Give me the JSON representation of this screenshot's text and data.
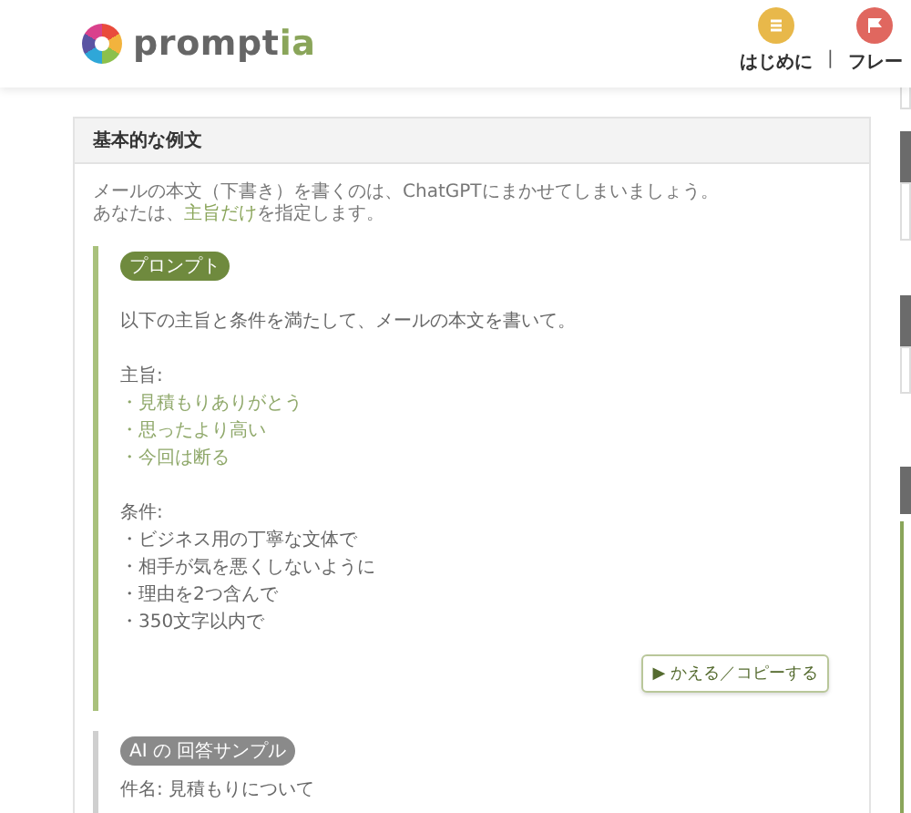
{
  "header": {
    "logo": [
      {
        "text": "prompt",
        "highlight": false
      },
      {
        "text": "ia",
        "highlight": true
      }
    ],
    "separator": "|",
    "nav": [
      {
        "label": "はじめに",
        "color": "#e8b84a",
        "kind": "list"
      },
      {
        "label": "フレー",
        "color": "#e0675f",
        "kind": "flag"
      }
    ]
  },
  "card": {
    "title": "基本的な例文",
    "intro": [
      [
        {
          "text": "メールの本文（下書き）を書くのは、ChatGPTにまかせてしまいましょう。",
          "highlight": false
        }
      ],
      [
        {
          "text": "あなたは、",
          "highlight": false
        },
        {
          "text": "主旨だけ",
          "highlight": true
        },
        {
          "text": "を指定します。",
          "highlight": false
        }
      ]
    ],
    "prompt": {
      "badge": "プロンプト",
      "instruction": "以下の主旨と条件を満たして、メールの本文を書いて。",
      "sections": [
        {
          "heading": "主旨:",
          "items": [
            {
              "text": "・見積もりありがとう",
              "highlight": true
            },
            {
              "text": "・思ったより高い",
              "highlight": true
            },
            {
              "text": "・今回は断る",
              "highlight": true
            }
          ]
        },
        {
          "heading": "条件:",
          "items": [
            {
              "text": "・ビジネス用の丁寧な文体で",
              "highlight": false
            },
            {
              "text": "・相手が気を悪くしないように",
              "highlight": false
            },
            {
              "text": "・理由を2つ含んで",
              "highlight": false
            },
            {
              "text": "・350文字以内で",
              "highlight": false
            }
          ]
        }
      ],
      "button": "▶ かえる／コピーする"
    },
    "answer": {
      "badge": "AI の 回答サンプル",
      "lines": [
        "件名: 見積もりについて"
      ]
    }
  }
}
